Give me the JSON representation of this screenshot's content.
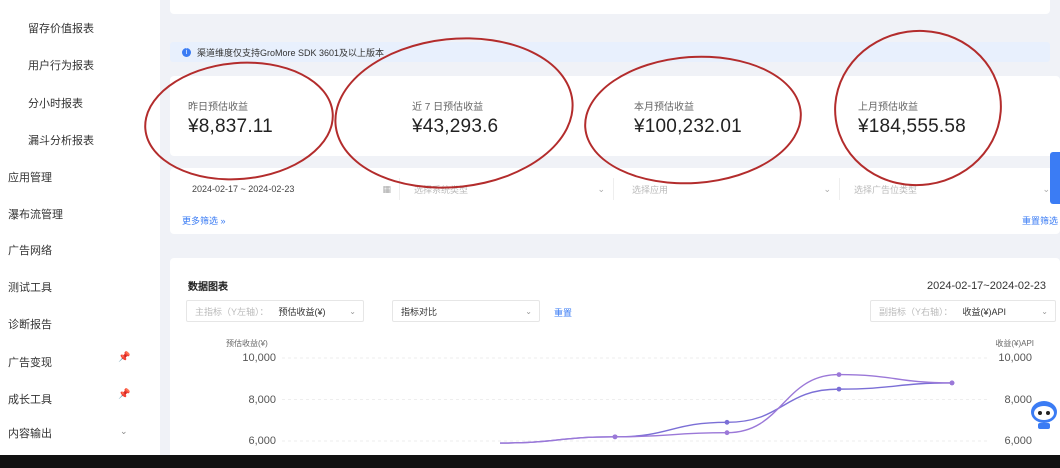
{
  "sidebar": {
    "sub_items": [
      {
        "label": "留存价值报表"
      },
      {
        "label": "用户行为报表"
      },
      {
        "label": "分小时报表"
      },
      {
        "label": "漏斗分析报表"
      }
    ],
    "items": [
      {
        "label": "应用管理"
      },
      {
        "label": "瀑布流管理"
      },
      {
        "label": "广告网络"
      },
      {
        "label": "测试工具"
      },
      {
        "label": "诊断报告"
      },
      {
        "label": "广告变现"
      },
      {
        "label": "成长工具"
      },
      {
        "label": "内容输出"
      }
    ]
  },
  "notice": {
    "text": "渠道维度仅支持GroMore SDK 3601及以上版本"
  },
  "stats": [
    {
      "label": "昨日预估收益",
      "value": "¥8,837.11"
    },
    {
      "label": "近 7 日预估收益",
      "value": "¥43,293.6"
    },
    {
      "label": "本月预估收益",
      "value": "¥100,232.01"
    },
    {
      "label": "上月预估收益",
      "value": "¥184,555.58"
    }
  ],
  "filters": {
    "date_range": "2024-02-17 ~ 2024-02-23",
    "system_type_placeholder": "选择系统类型",
    "app_placeholder": "选择应用",
    "ad_type_placeholder": "选择广告位类型",
    "more_filter": "更多筛选",
    "reset": "重置筛选"
  },
  "chart_section": {
    "title": "数据图表",
    "range": "2024-02-17~2024-02-23",
    "primary_metric_key": "主指标（Y左轴）：",
    "primary_metric_value": "预估收益(¥)",
    "compare_placeholder": "指标对比",
    "reset": "重置",
    "secondary_metric_key": "副指标（Y右轴）：",
    "secondary_metric_value": "收益(¥)API"
  },
  "chart_data": {
    "type": "line",
    "y_left_label": "预估收益(¥)",
    "y_right_label": "收益(¥)API",
    "y_ticks_left": [
      "10,000",
      "8,000",
      "6,000"
    ],
    "y_ticks_right": [
      "10,000",
      "8,000",
      "6,000"
    ],
    "ylim": [
      5500,
      10500
    ],
    "x": [
      0,
      1,
      2,
      3,
      4
    ],
    "series": [
      {
        "color": "#7b6fd6",
        "values": [
          5900,
          6200,
          6900,
          8500,
          8800
        ]
      },
      {
        "color": "#9b78d8",
        "values": [
          5900,
          6200,
          6400,
          9200,
          8800
        ]
      }
    ]
  },
  "colors": {
    "accent": "#3b7cf4",
    "annotation": "#b32c2c"
  }
}
